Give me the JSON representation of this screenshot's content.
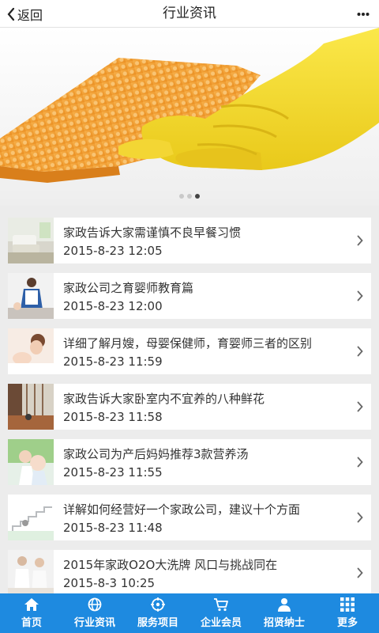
{
  "header": {
    "back_label": "返回",
    "title": "行业资讯",
    "more_icon": "more-dots-icon"
  },
  "banner": {
    "slides": 3,
    "active_slide": 3,
    "image": "yellow-glove-cleaning-sponge"
  },
  "articles": [
    {
      "title": "家政告诉大家需谨慎不良早餐习惯",
      "date": "2015-8-23 12:05",
      "thumb": "living-room"
    },
    {
      "title": "家政公司之育婴师教育篇",
      "date": "2015-8-23 12:00",
      "thumb": "caregiver-baby"
    },
    {
      "title": "详细了解月嫂，母婴保健师，育婴师三者的区别",
      "date": "2015-8-23 11:59",
      "thumb": "mother-baby"
    },
    {
      "title": "家政告诉大家卧室内不宜养的八种鲜花",
      "date": "2015-8-23 11:58",
      "thumb": "bedroom-window"
    },
    {
      "title": "家政公司为产后妈妈推荐3款营养汤",
      "date": "2015-8-23 11:55",
      "thumb": "mother-child"
    },
    {
      "title": "详解如何经营好一个家政公司，建议十个方面",
      "date": "2015-8-23 11:48",
      "thumb": "stairs"
    },
    {
      "title": "2015年家政O2O大洗牌 风口与挑战同在",
      "date": "2015-8-3 10:25",
      "thumb": "women-chatting"
    }
  ],
  "tabbar": {
    "items": [
      {
        "label": "首页",
        "icon": "home-icon"
      },
      {
        "label": "行业资讯",
        "icon": "globe-icon"
      },
      {
        "label": "服务项目",
        "icon": "target-icon"
      },
      {
        "label": "企业会员",
        "icon": "cart-icon"
      },
      {
        "label": "招贤纳士",
        "icon": "person-icon"
      },
      {
        "label": "更多",
        "icon": "grid-icon"
      }
    ]
  },
  "colors": {
    "tabbar_bg": "#1e8ae0",
    "page_bg": "#ececec",
    "glove": "#f4dc2a",
    "sponge": "#f2a43c"
  }
}
